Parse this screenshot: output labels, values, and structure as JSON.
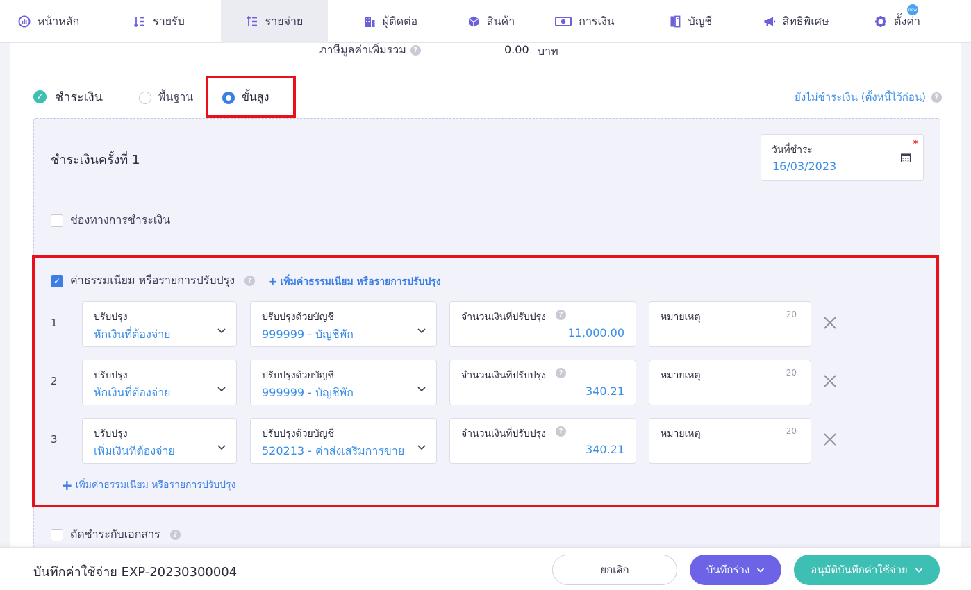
{
  "nav": {
    "items": [
      {
        "label": "หน้าหลัก",
        "icon": "dashboard-icon",
        "active": false
      },
      {
        "label": "รายรับ",
        "icon": "income-icon",
        "active": false
      },
      {
        "label": "รายจ่าย",
        "icon": "expense-icon",
        "active": true
      },
      {
        "label": "ผู้ติดต่อ",
        "icon": "contacts-icon",
        "active": false
      },
      {
        "label": "สินค้า",
        "icon": "box-icon",
        "active": false
      },
      {
        "label": "การเงิน",
        "icon": "money-icon",
        "active": false
      },
      {
        "label": "บัญชี",
        "icon": "ledger-icon",
        "active": false
      },
      {
        "label": "สิทธิพิเศษ",
        "icon": "megaphone-icon",
        "active": false
      },
      {
        "label": "ตั้งค่า",
        "icon": "gear-icon",
        "active": false
      }
    ],
    "badge": "new"
  },
  "vat": {
    "label": "ภาษีมูลค่าเพิ่มรวม",
    "value": "0.00",
    "unit": "บาท"
  },
  "payment": {
    "title": "ชำระเงิน",
    "mode_basic": "พื้นฐาน",
    "mode_advanced": "ขั้นสูง",
    "selected_mode": "advanced",
    "unpaid_link": "ยังไม่ชำระเงิน (ตั้งหนี้ไว้ก่อน)"
  },
  "installment": {
    "title": "ชำระเงินครั้งที่ 1",
    "date_label": "วันที่ชำระ",
    "date_value": "16/03/2023",
    "channel_label": "ช่องทางการชำระเงิน"
  },
  "fees": {
    "label": "ค่าธรรมเนียม หรือรายการปรับปรุง",
    "add_link_top": "+ เพิ่มค่าธรรมเนียม หรือรายการปรับปรุง",
    "add_link_bottom": "เพิ่มค่าธรรมเนียม หรือรายการปรับปรุง",
    "field_labels": {
      "adjust": "ปรับปรุง",
      "account": "ปรับปรุงด้วยบัญชี",
      "amount": "จำนวนเงินที่ปรับปรุง",
      "note": "หมายเหตุ"
    },
    "note_max": "20",
    "rows": [
      {
        "num": "1",
        "adjust": "หักเงินที่ต้องจ่าย",
        "account": "999999 - บัญชีพัก",
        "amount": "11,000.00"
      },
      {
        "num": "2",
        "adjust": "หักเงินที่ต้องจ่าย",
        "account": "999999 - บัญชีพัก",
        "amount": "340.21"
      },
      {
        "num": "3",
        "adjust": "เพิ่มเงินที่ต้องจ่าย",
        "account": "520213 - ค่าส่งเสริมการขาย",
        "amount": "340.21"
      }
    ]
  },
  "offset": {
    "label": "ตัดชำระกับเอกสาร"
  },
  "footer": {
    "doc_title": "บันทึกค่าใช้จ่าย EXP-20230300004",
    "cancel": "ยกเลิก",
    "save_draft": "บันทึกร่าง",
    "approve": "อนุมัติบันทึกค่าใช้จ่าย"
  },
  "colors": {
    "accent": "#6c63e6",
    "teal": "#3dbfb3",
    "link": "#3a8ee8",
    "highlight": "#e8101b"
  }
}
